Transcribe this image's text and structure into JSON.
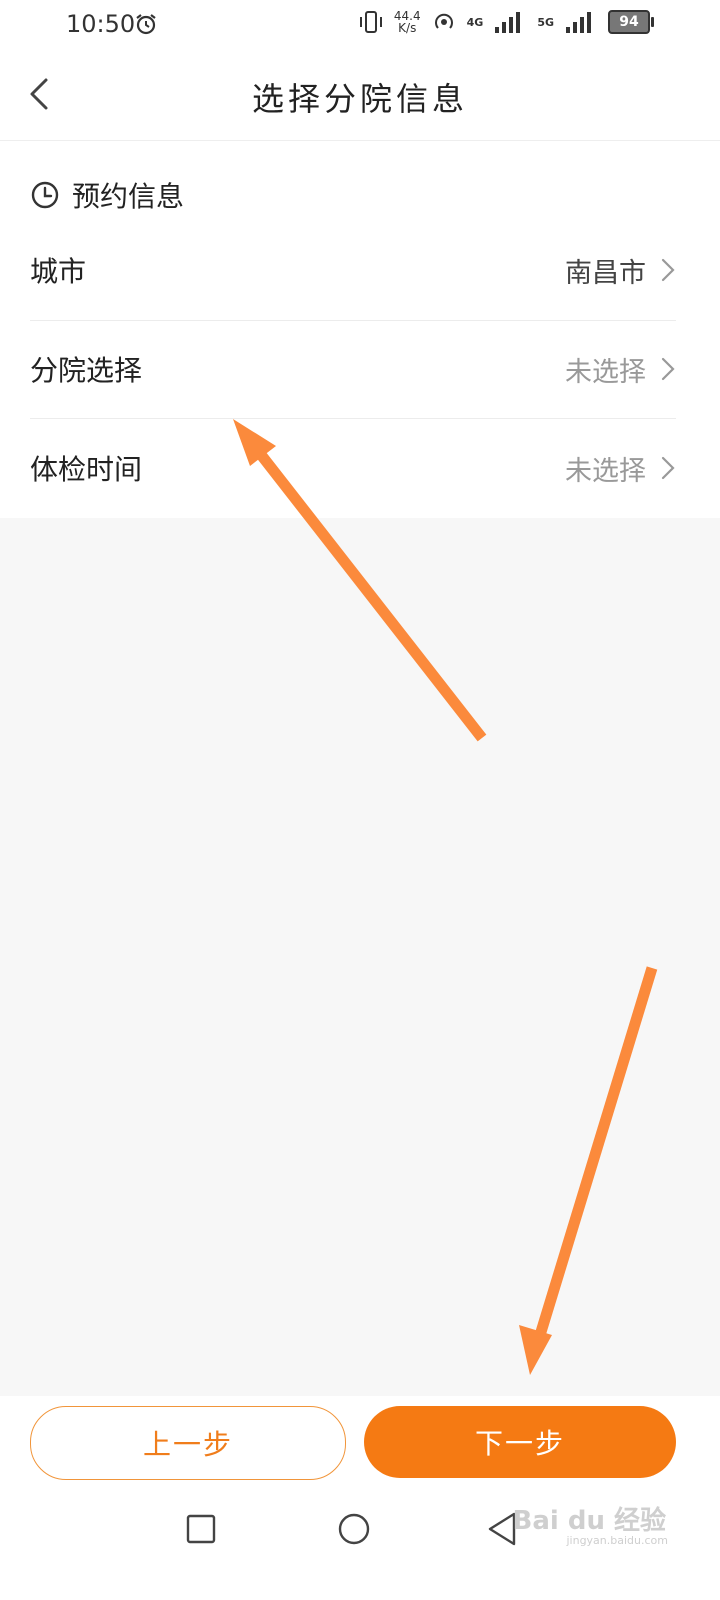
{
  "status_bar": {
    "time": "10:50",
    "net_speed_value": "44.4",
    "net_speed_unit": "K/s",
    "network": "4G",
    "network2": "5G",
    "battery": "94",
    "icons": [
      "alarm-icon",
      "vibrate-icon",
      "hotspot-icon",
      "signal-icon",
      "battery-icon"
    ]
  },
  "header": {
    "title": "选择分院信息",
    "back_icon": "chevron-left-icon"
  },
  "appointment": {
    "section_title": "预约信息",
    "section_icon": "clock-icon",
    "rows": [
      {
        "label": "城市",
        "value": "南昌市"
      },
      {
        "label": "分院选择",
        "value": "未选择"
      },
      {
        "label": "体检时间",
        "value": "未选择"
      }
    ]
  },
  "footer": {
    "prev_label": "上一步",
    "next_label": "下一步"
  },
  "system_nav": {
    "watermark": "Bai du 经验",
    "watermark_sub": "jingyan.baidu.com"
  },
  "colors": {
    "accent": "#f57a13",
    "annotation_arrow": "#fb8a3c",
    "muted_text": "#999999",
    "page_bg": "#f7f7f7"
  }
}
